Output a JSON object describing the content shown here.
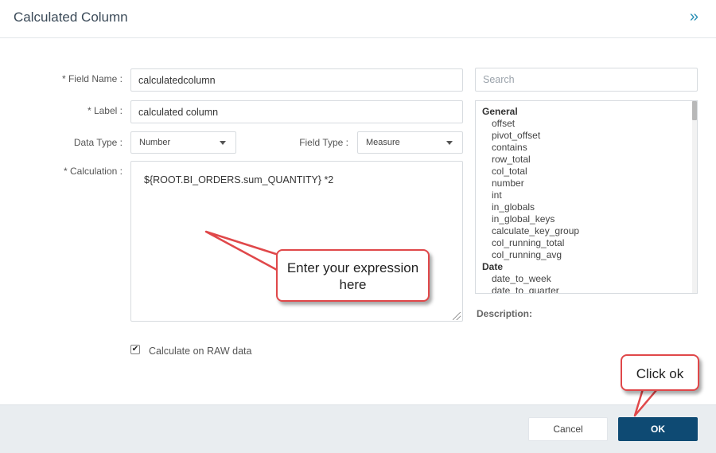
{
  "dialog": {
    "title": "Calculated Column",
    "collapse_icon": "double-chevron-right-icon"
  },
  "form": {
    "field_name": {
      "label": "* Field Name :",
      "value": "calculatedcolumn"
    },
    "label_field": {
      "label": "* Label :",
      "value": "calculated column"
    },
    "data_type": {
      "label": "Data Type :",
      "selected": "Number"
    },
    "field_type": {
      "label": "Field Type :",
      "selected": "Measure"
    },
    "calculation": {
      "label": "* Calculation :",
      "value": "${ROOT.BI_ORDERS.sum_QUANTITY} *2"
    },
    "raw_data": {
      "label": "Calculate on RAW data",
      "checked": true
    }
  },
  "function_panel": {
    "search_placeholder": "Search",
    "groups": [
      {
        "name": "General",
        "items": [
          "offset",
          "pivot_offset",
          "contains",
          "row_total",
          "col_total",
          "number",
          "int",
          "in_globals",
          "in_global_keys",
          "calculate_key_group",
          "col_running_total",
          "col_running_avg"
        ]
      },
      {
        "name": "Date",
        "items": [
          "date_to_week",
          "date_to_quarter"
        ]
      }
    ],
    "description_label": "Description:"
  },
  "footer": {
    "cancel_label": "Cancel",
    "ok_label": "OK"
  },
  "annotations": {
    "expression_callout": "Enter your expression here",
    "ok_callout": "Click ok",
    "callout_color": "#e0484a"
  }
}
